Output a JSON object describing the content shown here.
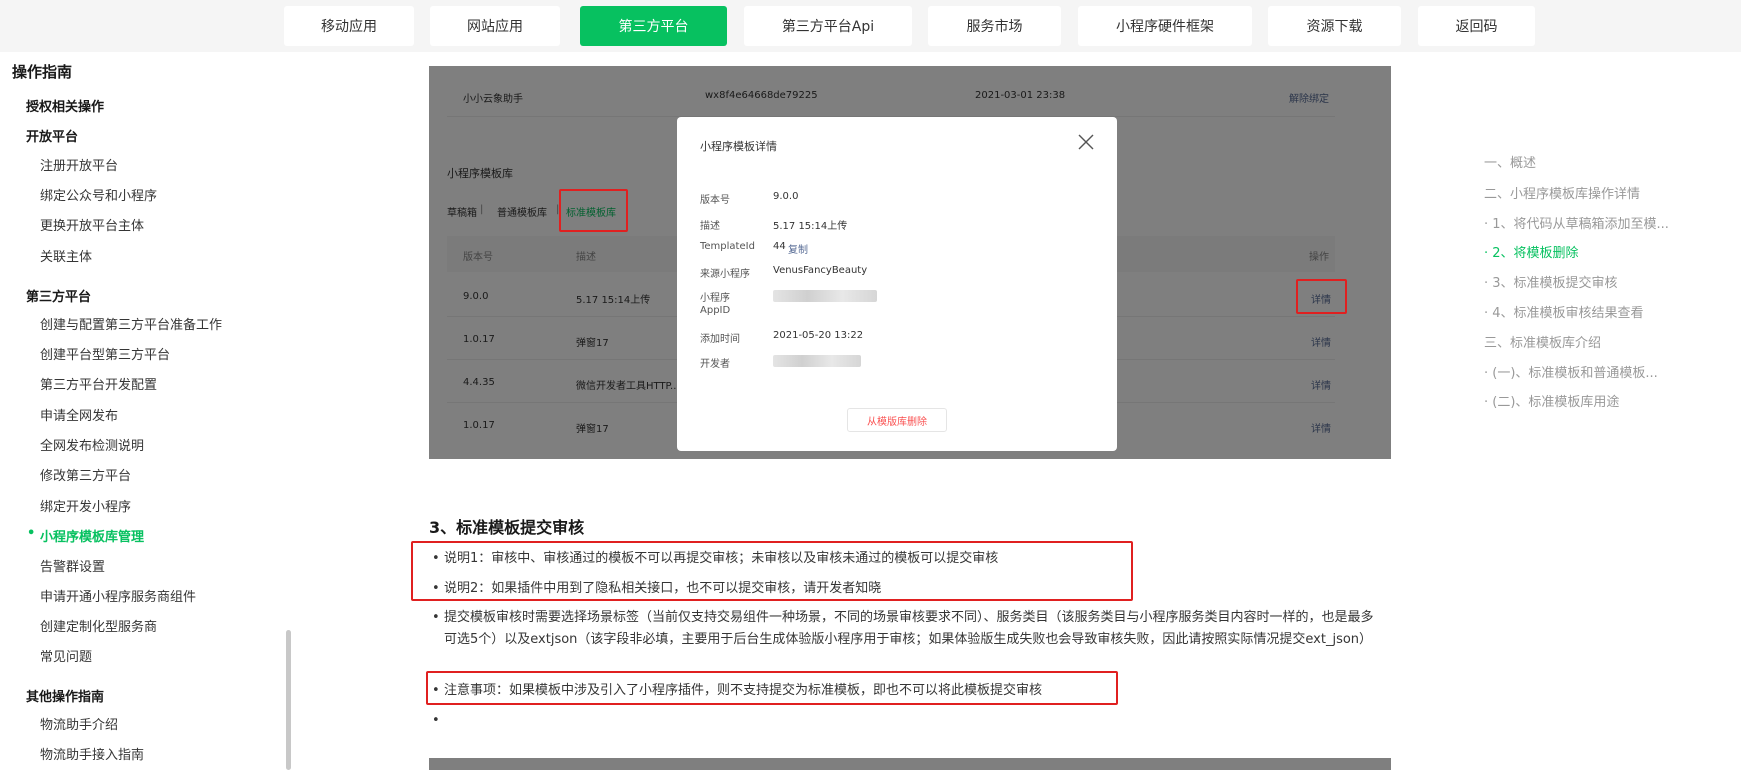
{
  "topnav": {
    "tabs": [
      {
        "label": "移动应用"
      },
      {
        "label": "网站应用"
      },
      {
        "label": "第三方平台"
      },
      {
        "label": "第三方平台Api"
      },
      {
        "label": "服务市场"
      },
      {
        "label": "小程序硬件框架"
      },
      {
        "label": "资源下载"
      },
      {
        "label": "返回码"
      }
    ],
    "active_index": 2
  },
  "sidebar": {
    "heading": "操作指南",
    "items": [
      {
        "label": "授权相关操作"
      },
      {
        "label": "开放平台"
      },
      {
        "label": "注册开放平台"
      },
      {
        "label": "绑定公众号和小程序"
      },
      {
        "label": "更换开放平台主体"
      },
      {
        "label": "关联主体"
      },
      {
        "label": "第三方平台"
      },
      {
        "label": "创建与配置第三方平台准备工作"
      },
      {
        "label": "创建平台型第三方平台"
      },
      {
        "label": "第三方平台开发配置"
      },
      {
        "label": "申请全网发布"
      },
      {
        "label": "全网发布检测说明"
      },
      {
        "label": "修改第三方平台"
      },
      {
        "label": "绑定开发小程序"
      },
      {
        "label": "小程序模板库管理"
      },
      {
        "label": "告警群设置"
      },
      {
        "label": "申请开通小程序服务商组件"
      },
      {
        "label": "创建定制化型服务商"
      },
      {
        "label": "常见问题"
      },
      {
        "label": "其他操作指南"
      },
      {
        "label": "物流助手介绍"
      },
      {
        "label": "物流助手接入指南"
      }
    ],
    "active_item": "小程序模板库管理"
  },
  "screenshot": {
    "top_row": {
      "name": "小小云象助手",
      "appid": "wx8f4e64668de79225",
      "time": "2021-03-01 23:38",
      "action": "解除绑定"
    },
    "library_title": "小程序模板库",
    "lib_tabs": [
      "草稿箱",
      "普通模板库",
      "标准模板库"
    ],
    "separator": "|",
    "columns": {
      "version": "版本号",
      "desc": "描述",
      "action": "操作"
    },
    "rows": [
      {
        "version": "9.0.0",
        "desc": "5.17 15:14上传",
        "action": "详情"
      },
      {
        "version": "1.0.17",
        "desc": "弹窗17",
        "action": "详情"
      },
      {
        "version": "4.4.35",
        "desc": "微信开发者工具HTTP...",
        "action": "详情"
      },
      {
        "version": "1.0.17",
        "desc": "弹窗17",
        "action": "详情"
      }
    ]
  },
  "modal": {
    "title": "小程序模板详情",
    "fields": {
      "version": {
        "label": "版本号",
        "value": "9.0.0"
      },
      "desc": {
        "label": "描述",
        "value": "5.17 15:14上传"
      },
      "template_id": {
        "label": "TemplateId",
        "value": "44",
        "copy": "复制"
      },
      "source": {
        "label": "来源小程序",
        "value": "VenusFancyBeauty"
      },
      "appid": {
        "label_line1": "小程序",
        "label_line2": "AppID"
      },
      "added": {
        "label": "添加时间",
        "value": "2021-05-20 13:22"
      },
      "developer": {
        "label": "开发者"
      }
    },
    "delete_button": "从模版库删除"
  },
  "content": {
    "section_title": "3、标准模板提交审核",
    "bullets": [
      "说明1：审核中、审核通过的模板不可以再提交审核；未审核以及审核未通过的模板可以提交审核",
      "说明2：如果插件中用到了隐私相关接口，也不可以提交审核，请开发者知晓",
      "提交模板审核时需要选择场景标签（当前仅支持交易组件一种场景，不同的场景审核要求不同）、服务类目（该服务类目与小程序服务类目内容时一样的，也是最多可选5个）以及extjson（该字段非必填，主要用于后台生成体验版小程序用于审核；如果体验版生成失败也会导致审核失败，因此请按照实际情况提交ext_json）",
      "注意事项：如果模板中涉及引入了小程序插件，则不支持提交为标准模板，即也不可以将此模板提交审核",
      ""
    ]
  },
  "toc": {
    "items": [
      {
        "label": "一、概述"
      },
      {
        "label": "二、小程序模板库操作详情"
      },
      {
        "label": "· 1、将代码从草稿箱添加至模..."
      },
      {
        "label": "· 2、将模板删除"
      },
      {
        "label": "· 3、标准模板提交审核"
      },
      {
        "label": "· 4、标准模板审核结果查看"
      },
      {
        "label": "三、标准模板库介绍"
      },
      {
        "label": "· (一)、标准模板和普通模板..."
      },
      {
        "label": "· (二)、标准模板库用途"
      }
    ],
    "active_item": "· 2、将模板删除"
  },
  "colors": {
    "accent": "#07c160",
    "highlight_border": "#e02020",
    "danger": "#fa5151"
  }
}
